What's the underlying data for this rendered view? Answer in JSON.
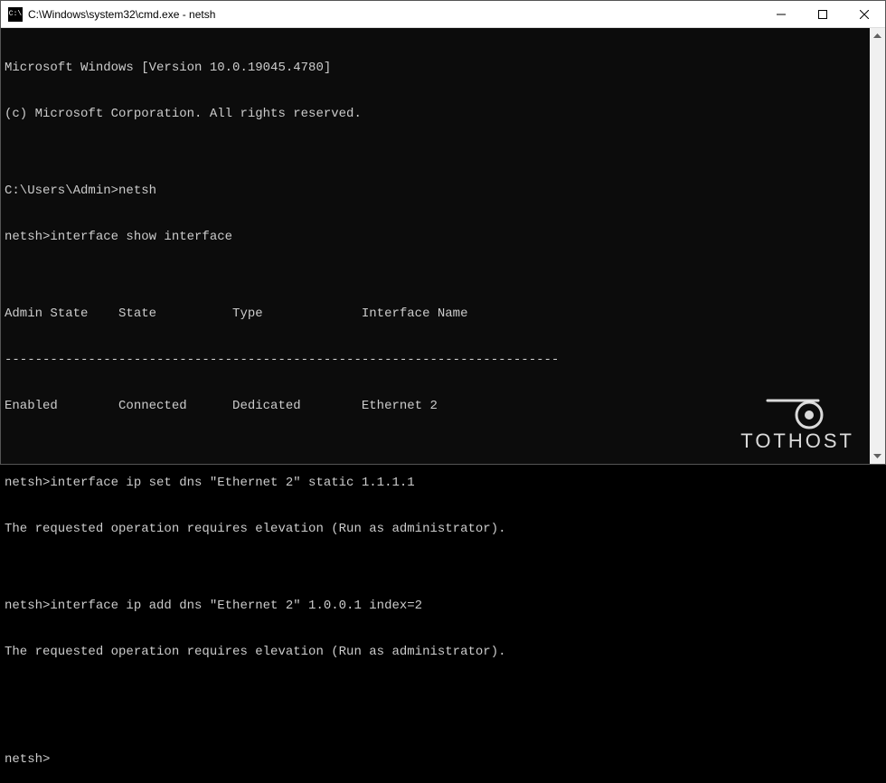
{
  "window": {
    "title": "C:\\Windows\\system32\\cmd.exe - netsh",
    "icon_label": "C:\\"
  },
  "terminal": {
    "lines": [
      "Microsoft Windows [Version 10.0.19045.4780]",
      "(c) Microsoft Corporation. All rights reserved.",
      "",
      "C:\\Users\\Admin>netsh",
      "netsh>interface show interface",
      "",
      "Admin State    State          Type             Interface Name",
      "-------------------------------------------------------------------------",
      "Enabled        Connected      Dedicated        Ethernet 2",
      "",
      "netsh>interface ip set dns \"Ethernet 2\" static 1.1.1.1",
      "The requested operation requires elevation (Run as administrator).",
      "",
      "netsh>interface ip add dns \"Ethernet 2\" 1.0.0.1 index=2",
      "The requested operation requires elevation (Run as administrator).",
      "",
      "",
      "netsh>"
    ]
  },
  "watermark": {
    "text": "TOTHOST"
  }
}
